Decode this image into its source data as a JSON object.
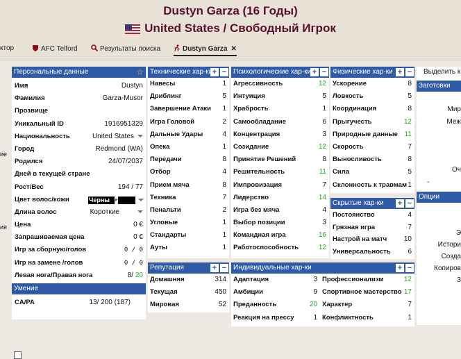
{
  "header": {
    "title": "Dustyn Garza (16 Годы)",
    "subtitle": "United States / Свободный Игрок"
  },
  "tabs": [
    {
      "label": "ктор"
    },
    {
      "label": "AFC Telford"
    },
    {
      "label": "Результаты поиска"
    },
    {
      "label": "Dustyn Garza"
    }
  ],
  "personal": {
    "title": "Персональные данные",
    "rows": [
      {
        "label": "Имя",
        "value": "Dustyn"
      },
      {
        "label": "Фамилия",
        "value": "Garza-Musor"
      },
      {
        "label": "Прозвище",
        "value": ""
      },
      {
        "label": "Уникальный ID",
        "value": "1916951329"
      },
      {
        "label": "Национальность",
        "value": "United States"
      },
      {
        "label": "Город",
        "value": "Redmond (WA)"
      },
      {
        "label": "Родился",
        "value": "24/07/2037"
      },
      {
        "label": "Дней в текущей стране",
        "value": ""
      },
      {
        "label": "Рост/Вес",
        "value": "194  /  77"
      },
      {
        "label": "Цвет волос/кожи",
        "value": "Черны"
      },
      {
        "label": "Длина волос",
        "value": "Короткие"
      },
      {
        "label": "Цена",
        "value": "0  €"
      },
      {
        "label": "Запрашиваемая цена",
        "value": "0  €"
      },
      {
        "label": "Игр за сборную/голов",
        "value": "0  /  0"
      },
      {
        "label": "Игр на замене /голов",
        "value": "0  /  0"
      },
      {
        "label": "Левая нога/Правая нога",
        "value": "8/",
        "value2": "20"
      }
    ]
  },
  "ability": {
    "title": "Умение",
    "label": "CA/PA",
    "value": "13/ 200 (187)"
  },
  "technical": {
    "title": "Технические хар-ки",
    "rows": [
      {
        "label": "Навесы",
        "value": "1"
      },
      {
        "label": "Дриблинг",
        "value": "5"
      },
      {
        "label": "Завершение Атаки",
        "value": "1"
      },
      {
        "label": "Игра Головой",
        "value": "2"
      },
      {
        "label": "Дальные Удары",
        "value": "4"
      },
      {
        "label": "Опека",
        "value": "1"
      },
      {
        "label": "Передачи",
        "value": "8"
      },
      {
        "label": "Отбор",
        "value": "4"
      },
      {
        "label": "Прием мяча",
        "value": "8"
      },
      {
        "label": "Техника",
        "value": "7"
      },
      {
        "label": "Пенальти",
        "value": "2"
      },
      {
        "label": "Угловые",
        "value": "1"
      },
      {
        "label": "Стандарты",
        "value": "1"
      },
      {
        "label": "Ауты",
        "value": "1"
      }
    ]
  },
  "mental": {
    "title": "Психологические хар-ки",
    "rows": [
      {
        "label": "Агрессивность",
        "value": "12",
        "green": true
      },
      {
        "label": "Интуиция",
        "value": "5"
      },
      {
        "label": "Храбрость",
        "value": "1"
      },
      {
        "label": "Самообладание",
        "value": "6"
      },
      {
        "label": "Концентрация",
        "value": "3"
      },
      {
        "label": "Созидание",
        "value": "12",
        "green": true
      },
      {
        "label": "Принятие Решений",
        "value": "8"
      },
      {
        "label": "Решительность",
        "value": "11",
        "green": true
      },
      {
        "label": "Импровизация",
        "value": "7"
      },
      {
        "label": "Лидерство",
        "value": "14",
        "green": true
      },
      {
        "label": "Игра без мяча",
        "value": "4"
      },
      {
        "label": "Выбор позиции",
        "value": "3"
      },
      {
        "label": "Командная игра",
        "value": "16",
        "green": true
      },
      {
        "label": "Работоспособность",
        "value": "12",
        "green": true
      }
    ]
  },
  "physical": {
    "title": "Физические хар-ки",
    "rows": [
      {
        "label": "Ускорение",
        "value": "8"
      },
      {
        "label": "Ловкость",
        "value": "5"
      },
      {
        "label": "Координация",
        "value": "8"
      },
      {
        "label": "Прыгучесть",
        "value": "12",
        "green": true
      },
      {
        "label": "Природные данные",
        "value": "11",
        "green": true
      },
      {
        "label": "Скорость",
        "value": "7"
      },
      {
        "label": "Выносливость",
        "value": "8"
      },
      {
        "label": "Сила",
        "value": "5"
      },
      {
        "label": "Склонность к травмам",
        "value": "1"
      }
    ]
  },
  "hidden": {
    "title": "Скрытые хар-ки",
    "rows": [
      {
        "label": "Постоянство",
        "value": "4"
      },
      {
        "label": "Грязная игра",
        "value": "7"
      },
      {
        "label": "Настрой на матч",
        "value": "10"
      },
      {
        "label": "Универсальность",
        "value": "6"
      }
    ]
  },
  "reputation": {
    "title": "Репутация",
    "rows": [
      {
        "label": "Домашняя",
        "value": "314"
      },
      {
        "label": "Текущая",
        "value": "450"
      },
      {
        "label": "Мировая",
        "value": "52"
      }
    ]
  },
  "individual": {
    "title": "Индивидуальные хар-ки",
    "left": [
      {
        "label": "Адаптация",
        "value": "3"
      },
      {
        "label": "Амбиции",
        "value": "9"
      },
      {
        "label": "Преданность",
        "value": "20",
        "green": true
      },
      {
        "label": "Реакция на прессу",
        "value": "1"
      }
    ],
    "right": [
      {
        "label": "Профессионализм",
        "value": "12",
        "green": true
      },
      {
        "label": "Спортивное мастерство",
        "value": "17",
        "green": true
      },
      {
        "label": "Характер",
        "value": "7"
      },
      {
        "label": "Конфликтность",
        "value": "1"
      }
    ]
  },
  "sidepanel": {
    "select_label": "Выделить к",
    "presets_title": "Заготовки",
    "options_title": "Опции",
    "left_fragments": [
      "ие",
      "ия"
    ],
    "right_fragments": [
      "Мир",
      "Меж",
      "Оч",
      "-",
      "Э",
      "Истори",
      "Созда",
      "Копиров",
      "З"
    ]
  },
  "colors": {
    "header_bg": "#2f5aa6",
    "title": "#5a0f2e",
    "good_value": "#2aa52a"
  }
}
